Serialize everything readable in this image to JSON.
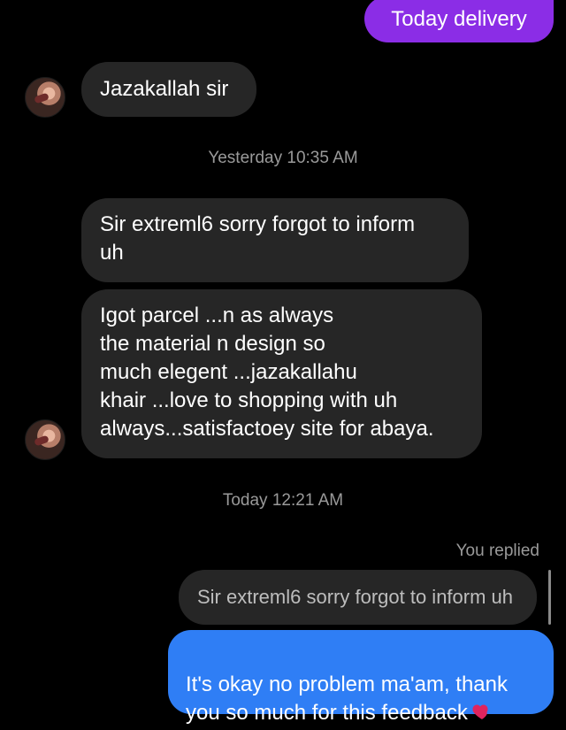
{
  "conversation": {
    "messages": [
      {
        "id": "msg1",
        "direction": "outgoing",
        "text": "Today delivery"
      },
      {
        "id": "msg2",
        "direction": "incoming",
        "text": "Jazakallah sir"
      },
      {
        "id": "msg3",
        "direction": "incoming",
        "text": "Sir extreml6 sorry forgot to inform\nuh"
      },
      {
        "id": "msg4",
        "direction": "incoming",
        "text": "Igot parcel ...n as always\nthe material n design so\nmuch elegent ...jazakallahu\nkhair ...love to shopping with uh\nalways...satisfactoey site for abaya."
      },
      {
        "id": "msg5",
        "direction": "outgoing",
        "text": "It's okay no problem ma'am, thank\nyou so much for this feedback"
      }
    ],
    "timestamps": {
      "yesterday": "Yesterday 10:35 AM",
      "today": "Today 12:21 AM"
    },
    "reply": {
      "label": "You replied",
      "quoted_text": "Sir extreml6 sorry forgot to inform uh"
    },
    "icons": {
      "avatar": "profile-avatar",
      "heart": "heart-icon"
    },
    "colors": {
      "background": "#000000",
      "incoming_bubble": "#262626",
      "outgoing_purple": "#8b2de6",
      "outgoing_blue": "#2f7ef5",
      "muted_text": "#9a9a9a",
      "heart": "#e0245e"
    }
  }
}
